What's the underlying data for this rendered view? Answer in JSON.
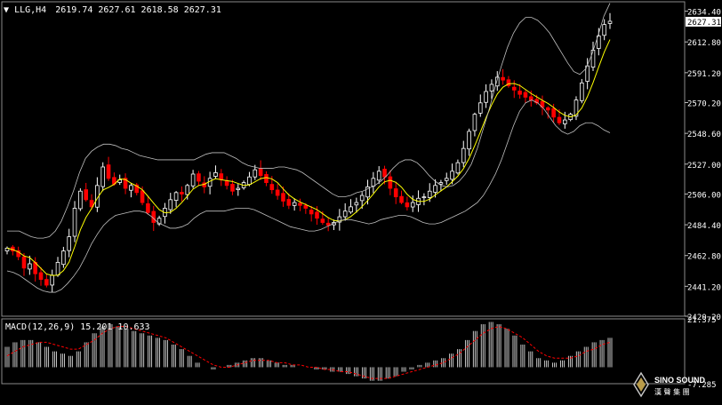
{
  "header": {
    "symbol": "LLG,H4",
    "ohlc": "2619.74 2627.61 2618.58 2627.31"
  },
  "macd_header": "MACD(12,26,9) 15.201 10.633",
  "watermark": {
    "text": "SINO SOUND",
    "subtext": "漢 聲 集 團"
  },
  "colors": {
    "background": "#000000",
    "bull": "#ffffff",
    "bear": "#ff0000",
    "ma": "#ffff00",
    "bands": "#c0c0c0",
    "signal": "#ff0000"
  },
  "chart_data": [
    {
      "type": "candlestick",
      "title": "LLG,H4",
      "price_range": [
        2420.2,
        2641.0
      ],
      "y_ticks": [
        2634.4,
        2612.8,
        2591.2,
        2570.2,
        2548.6,
        2527.0,
        2506.0,
        2484.4,
        2462.8,
        2441.2,
        2420.2
      ],
      "last_price": 2627.31,
      "overlays": [
        "Bollinger Bands",
        "Moving Average"
      ],
      "grid": false,
      "closes": [
        2468,
        2466,
        2462,
        2454,
        2457,
        2450,
        2446,
        2442,
        2449,
        2458,
        2466,
        2476,
        2496,
        2508,
        2502,
        2497,
        2512,
        2525,
        2517,
        2513,
        2516,
        2510,
        2512,
        2507,
        2500,
        2493,
        2486,
        2489,
        2496,
        2502,
        2507,
        2506,
        2512,
        2520,
        2515,
        2511,
        2517,
        2521,
        2516,
        2512,
        2508,
        2510,
        2514,
        2518,
        2523,
        2519,
        2514,
        2509,
        2505,
        2501,
        2498,
        2500,
        2498,
        2496,
        2492,
        2489,
        2486,
        2484,
        2486,
        2490,
        2494,
        2497,
        2500,
        2505,
        2511,
        2517,
        2522,
        2518,
        2510,
        2504,
        2500,
        2497,
        2500,
        2503,
        2504,
        2508,
        2512,
        2514,
        2517,
        2522,
        2528,
        2538,
        2550,
        2562,
        2570,
        2578,
        2583,
        2588,
        2586,
        2582,
        2579,
        2576,
        2574,
        2572,
        2570,
        2567,
        2565,
        2560,
        2556,
        2558,
        2562,
        2572,
        2584,
        2596,
        2607,
        2617,
        2625,
        2627.31
      ],
      "bb_upper": [
        2480,
        2480,
        2480,
        2478,
        2476,
        2475,
        2475,
        2476,
        2480,
        2487,
        2497,
        2508,
        2521,
        2531,
        2536,
        2539,
        2541,
        2541,
        2540,
        2538,
        2537,
        2535,
        2533,
        2532,
        2531,
        2530,
        2530,
        2530,
        2530,
        2530,
        2530,
        2530,
        2532,
        2534,
        2535,
        2535,
        2535,
        2533,
        2531,
        2528,
        2526,
        2525,
        2524,
        2524,
        2524,
        2525,
        2525,
        2524,
        2523,
        2521,
        2518,
        2515,
        2512,
        2509,
        2506,
        2504,
        2504,
        2505,
        2507,
        2508,
        2510,
        2512,
        2515,
        2519,
        2524,
        2528,
        2530,
        2530,
        2528,
        2524,
        2519,
        2515,
        2512,
        2511,
        2512,
        2515,
        2520,
        2527,
        2538,
        2552,
        2566,
        2582,
        2596,
        2609,
        2619,
        2626,
        2630,
        2630,
        2628,
        2624,
        2619,
        2612,
        2605,
        2598,
        2592,
        2590,
        2594,
        2604,
        2617,
        2631,
        2640
      ],
      "bb_lower": [
        2452,
        2451,
        2449,
        2446,
        2443,
        2440,
        2438,
        2437,
        2437,
        2439,
        2443,
        2448,
        2454,
        2462,
        2471,
        2478,
        2484,
        2488,
        2491,
        2492,
        2493,
        2494,
        2494,
        2493,
        2490,
        2486,
        2484,
        2482,
        2482,
        2483,
        2485,
        2489,
        2492,
        2494,
        2494,
        2494,
        2494,
        2495,
        2496,
        2496,
        2496,
        2495,
        2493,
        2491,
        2489,
        2487,
        2485,
        2483,
        2482,
        2481,
        2480,
        2480,
        2481,
        2483,
        2485,
        2487,
        2488,
        2488,
        2487,
        2486,
        2485,
        2486,
        2488,
        2489,
        2490,
        2491,
        2491,
        2490,
        2488,
        2486,
        2485,
        2485,
        2486,
        2488,
        2490,
        2492,
        2494,
        2497,
        2500,
        2505,
        2512,
        2520,
        2530,
        2542,
        2554,
        2564,
        2570,
        2572,
        2570,
        2566,
        2560,
        2554,
        2550,
        2548,
        2550,
        2554,
        2556,
        2556,
        2554,
        2551,
        2549
      ],
      "macd_range": [
        -7.285,
        21.375
      ],
      "macd_ticks": [
        21.375,
        -7.285
      ],
      "macd_hist": [
        9,
        11,
        12,
        12,
        11,
        9,
        7,
        6,
        5,
        7,
        11,
        15,
        18,
        19,
        18,
        17,
        16,
        15,
        14,
        13,
        12,
        10,
        8,
        5,
        2,
        0,
        -1,
        0,
        1,
        2,
        3,
        4,
        4,
        3,
        2,
        1,
        1,
        0,
        0,
        -1,
        -1,
        -2,
        -2,
        -3,
        -4,
        -5,
        -6,
        -6,
        -5,
        -4,
        -2,
        -1,
        1,
        2,
        3,
        4,
        6,
        8,
        12,
        16,
        19,
        20,
        19,
        17,
        14,
        10,
        7,
        4,
        3,
        2,
        3,
        5,
        7,
        9,
        11,
        12,
        13
      ],
      "macd_signal": [
        5,
        7,
        9,
        10,
        11,
        11,
        10,
        9,
        8,
        8,
        10,
        12,
        15,
        17,
        18,
        18,
        17,
        16,
        15,
        14,
        13,
        11,
        9,
        7,
        5,
        3,
        1,
        0,
        0,
        1,
        2,
        3,
        3,
        3,
        2,
        2,
        1,
        1,
        0,
        0,
        -1,
        -1,
        -2,
        -2,
        -3,
        -4,
        -5,
        -5,
        -5,
        -4,
        -3,
        -2,
        -1,
        0,
        1,
        2,
        4,
        6,
        9,
        12,
        15,
        17,
        18,
        17,
        15,
        13,
        10,
        7,
        5,
        4,
        4,
        4,
        5,
        7,
        8,
        10,
        11
      ]
    }
  ]
}
